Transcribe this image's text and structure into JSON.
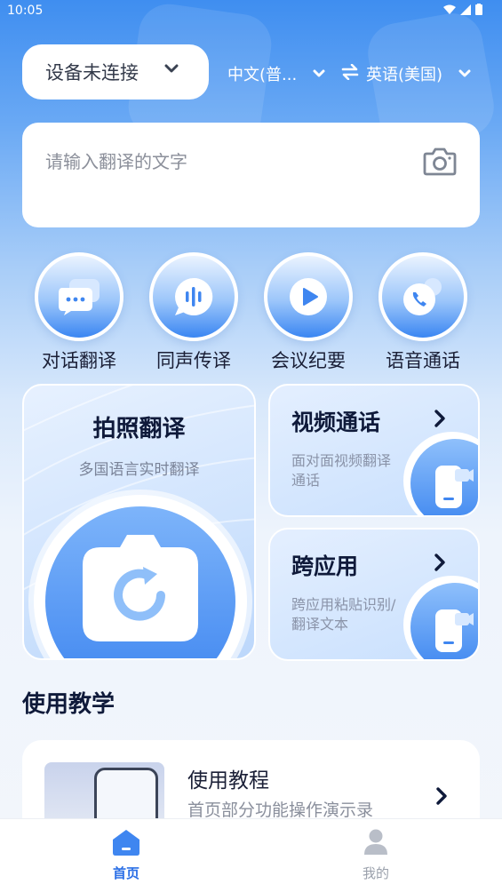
{
  "status_bar": {
    "time": "10:05"
  },
  "header": {
    "device_status": "设备未连接",
    "source_language": "中文(普...",
    "target_language": "英语(美国)"
  },
  "input": {
    "placeholder": "请输入翻译的文字"
  },
  "features": [
    {
      "label": "对话翻译",
      "icon": "chat-bubble-icon"
    },
    {
      "label": "同声传译",
      "icon": "voice-wave-icon"
    },
    {
      "label": "会议纪要",
      "icon": "play-icon"
    },
    {
      "label": "语音通话",
      "icon": "phone-icon"
    }
  ],
  "cards": {
    "photo": {
      "title": "拍照翻译",
      "subtitle": "多国语言实时翻译"
    },
    "video": {
      "title": "视频通话",
      "desc": "面对面视频翻译通话"
    },
    "cross_app": {
      "title": "跨应用",
      "desc": "跨应用粘贴识别/翻译文本"
    }
  },
  "tutorial_section": {
    "title": "使用教学",
    "item": {
      "title": "使用教程",
      "desc": "首页部分功能操作演示录"
    }
  },
  "tab_bar": {
    "tabs": [
      {
        "label": "首页",
        "active": true
      },
      {
        "label": "我的",
        "active": false
      }
    ]
  },
  "colors": {
    "accent": "#2b6fe6",
    "primary_blue": "#3f86f0",
    "text_dark": "#0f1a3a"
  }
}
